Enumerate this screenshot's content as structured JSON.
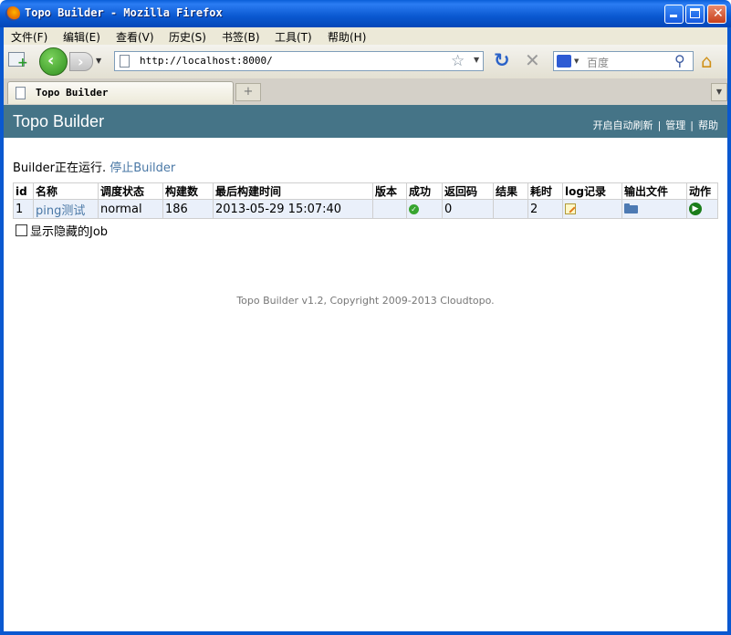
{
  "window": {
    "title": "Topo Builder - Mozilla Firefox"
  },
  "menu": {
    "items": [
      "文件(F)",
      "编辑(E)",
      "查看(V)",
      "历史(S)",
      "书签(B)",
      "工具(T)",
      "帮助(H)"
    ]
  },
  "nav": {
    "url": "http://localhost:8000/",
    "search_placeholder": "百度"
  },
  "tab": {
    "title": "Topo Builder",
    "new_tab_glyph": "+"
  },
  "header": {
    "brand": "Topo Builder",
    "links": [
      "开启自动刷新",
      "管理",
      "帮助"
    ]
  },
  "status": {
    "text": "Builder正在运行.",
    "stop_link": "停止Builder"
  },
  "table": {
    "columns": [
      "id",
      "名称",
      "调度状态",
      "构建数",
      "最后构建时间",
      "版本",
      "成功",
      "返回码",
      "结果",
      "耗时",
      "log记录",
      "输出文件",
      "动作"
    ],
    "rows": [
      {
        "id": "1",
        "name": "ping测试",
        "schedule": "normal",
        "builds": "186",
        "last_build": "2013-05-29 15:07:40",
        "version": "",
        "success_icon": "check-icon",
        "return_code": "0",
        "result": "",
        "duration": "2",
        "log_icon": "edit-log-icon",
        "output_icon": "folder-icon",
        "action_icon": "run-icon"
      }
    ]
  },
  "options": {
    "show_hidden_label": "显示隐藏的Job"
  },
  "footer": {
    "text": "Topo Builder v1.2, Copyright 2009-2013 Cloudtopo."
  },
  "colors": {
    "header_bg": "#457487",
    "link": "#4a78a6",
    "row_bg": "#eaf0fa",
    "success": "#37a52f"
  }
}
